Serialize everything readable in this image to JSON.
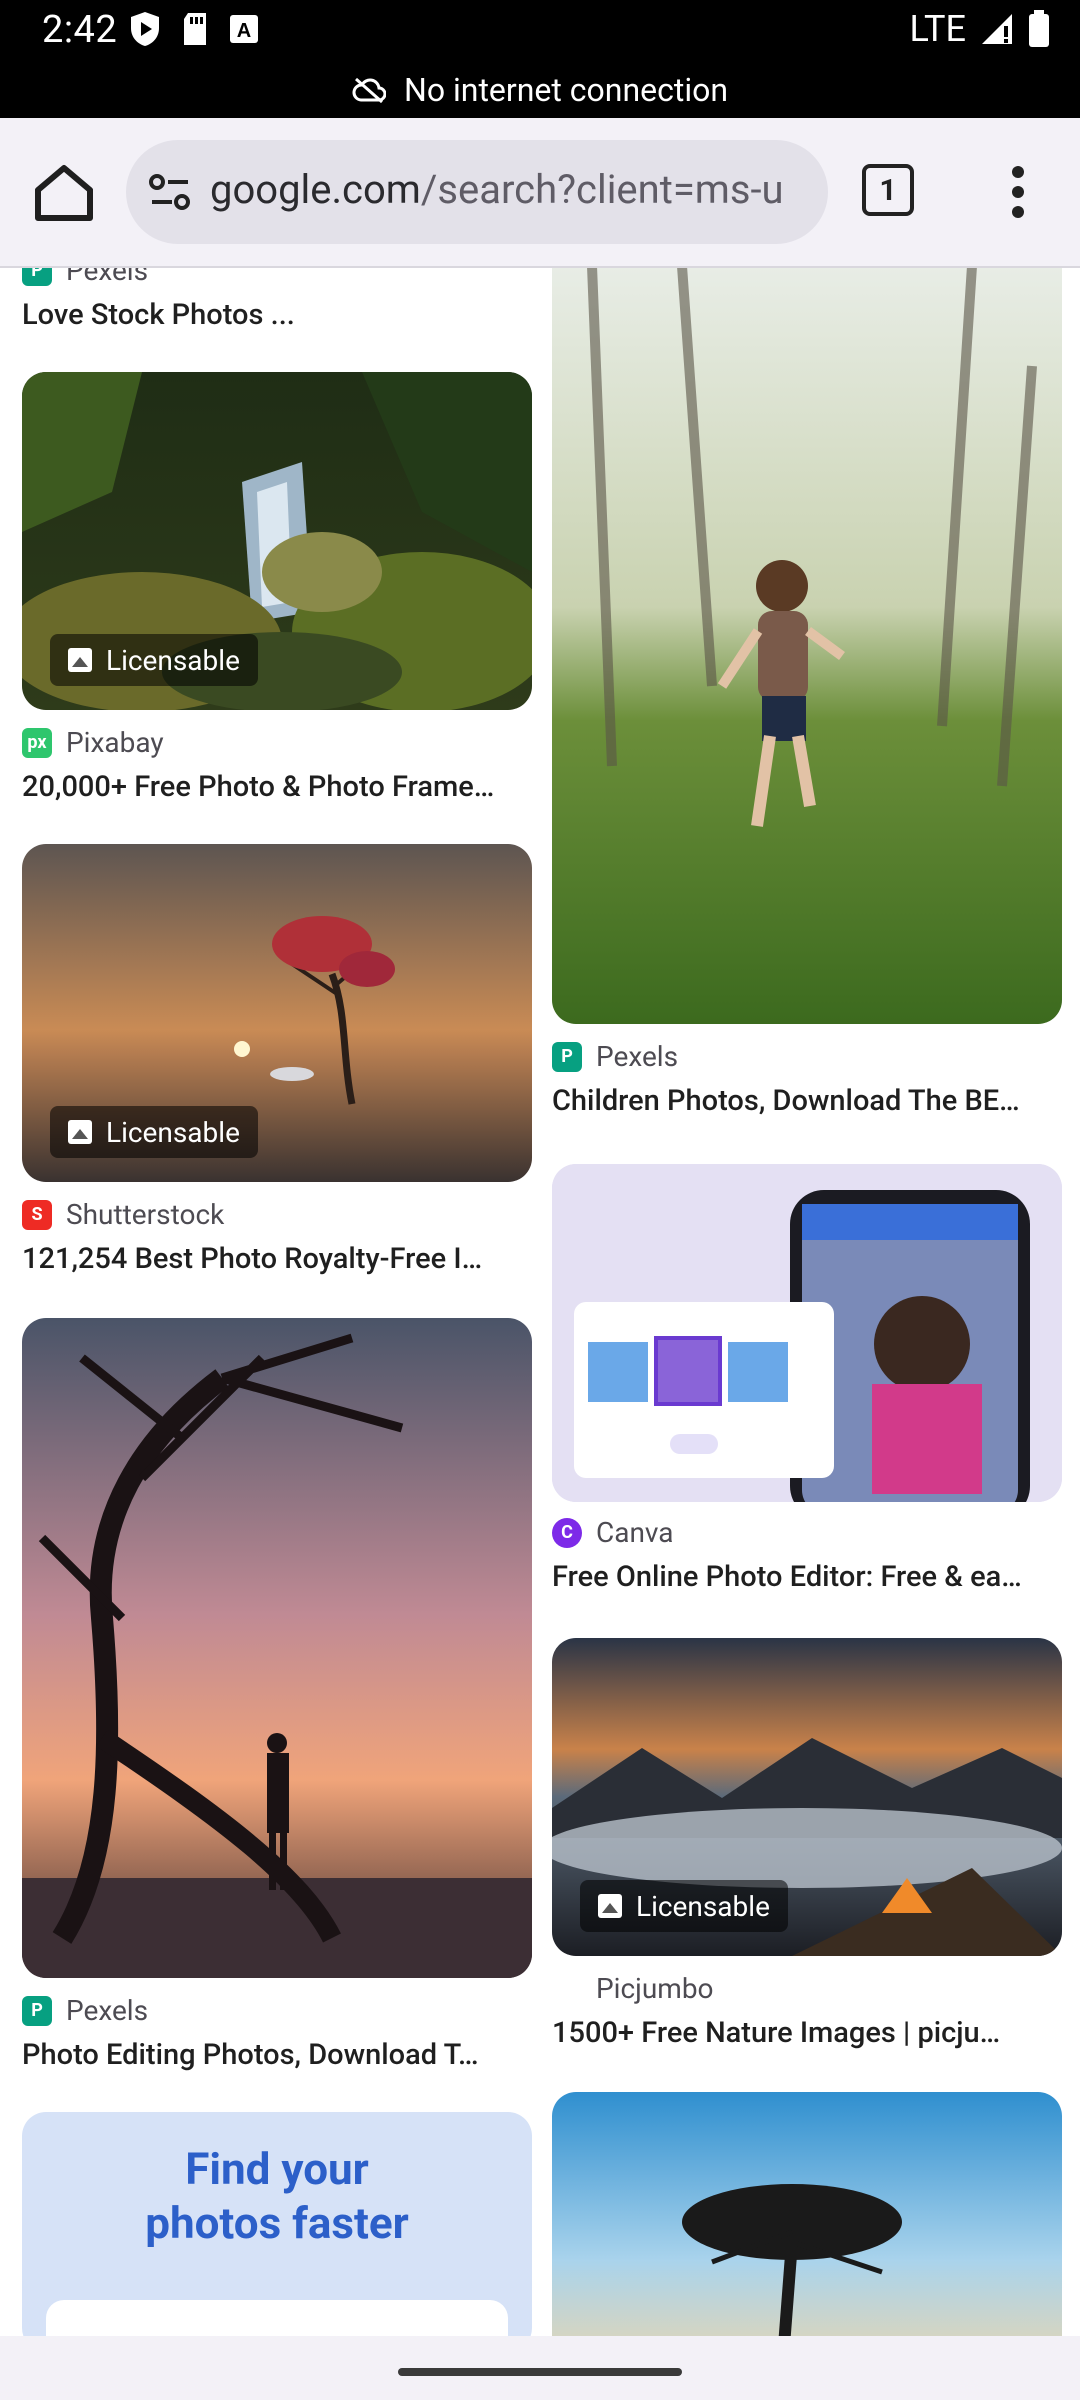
{
  "status_bar": {
    "time": "2:42",
    "network": "LTE"
  },
  "banner": {
    "text": "No internet connection"
  },
  "toolbar": {
    "url_main": "google.com",
    "url_rest": "/search?client=ms-u",
    "tab_count": "1"
  },
  "results": [
    {
      "source": "Pexels",
      "title": "Love Stock Photos ..."
    },
    {
      "source": "Pixabay",
      "title": "20,000+ Free Photo & Photo Frame…",
      "badge": "Licensable"
    },
    {
      "source": "Shutterstock",
      "title": "121,254 Best Photo Royalty-Free I…",
      "badge": "Licensable"
    },
    {
      "source": "Pexels",
      "title": "Photo Editing Photos, Download T…"
    },
    {
      "source": "Pexels",
      "title": "Children Photos, Download The BE…"
    },
    {
      "source": "Canva",
      "title": "Free Online Photo Editor: Free & ea…"
    },
    {
      "source": "Picjumbo",
      "title": "1500+ Free Nature Images | picju…",
      "badge": "Licensable"
    }
  ],
  "promo": {
    "line1": "Find your",
    "line2": "photos faster"
  },
  "colors": {
    "toolbar_bg": "#f3f1f7",
    "omnibox_bg": "#e3e1e9",
    "pexels": "#07a081",
    "pixabay": "#2ec66d",
    "shutterstock": "#ee2b24",
    "canva": "#7d2ae8"
  }
}
